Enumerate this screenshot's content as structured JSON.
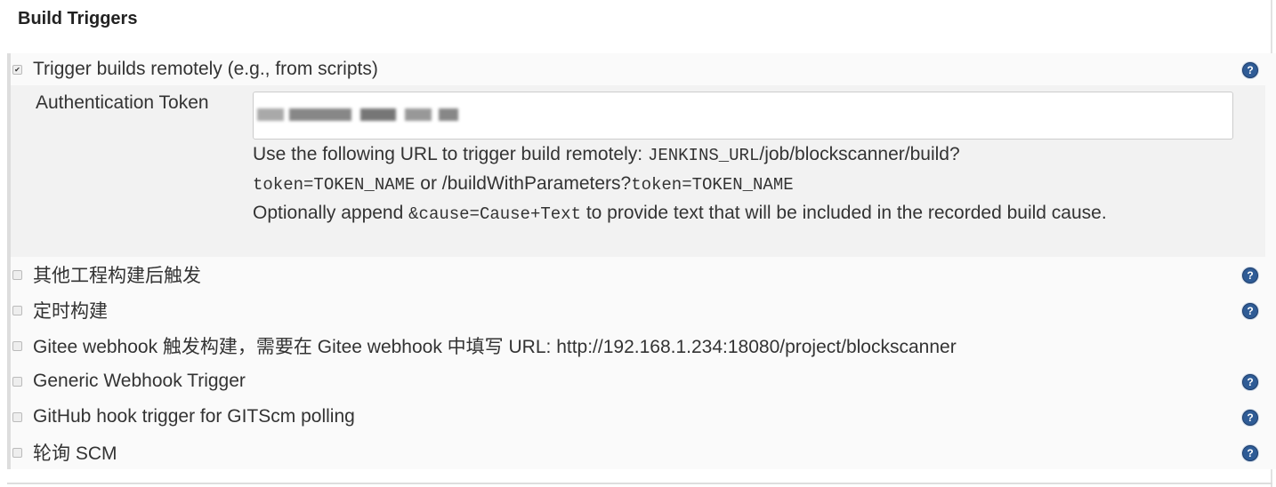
{
  "title": "Build Triggers",
  "remote": {
    "label": "Trigger builds remotely (e.g., from scripts)",
    "checked": true,
    "auth_label": "Authentication Token",
    "desc1a": "Use the following URL to trigger build remotely: ",
    "desc1code": "JENKINS_URL",
    "desc1b": "/job/blockscanner/build?",
    "desc2code1": "token=TOKEN_NAME",
    "desc2b": " or /buildWithParameters?",
    "desc2code2": "token=TOKEN_NAME",
    "desc3a": "Optionally append ",
    "desc3code": "&cause=Cause+Text",
    "desc3b": " to provide text that will be included in the recorded build cause."
  },
  "triggers": [
    {
      "label": "其他工程构建后触发",
      "checked": false,
      "help": true
    },
    {
      "label": "定时构建",
      "checked": false,
      "help": true
    },
    {
      "label": "Gitee webhook 触发构建，需要在 Gitee webhook 中填写 URL: http://192.168.1.234:18080/project/blockscanner",
      "checked": false,
      "help": false
    },
    {
      "label": "Generic Webhook Trigger",
      "checked": false,
      "help": true
    },
    {
      "label": "GitHub hook trigger for GITScm polling",
      "checked": false,
      "help": true
    },
    {
      "label": "轮询 SCM",
      "checked": false,
      "help": true
    }
  ],
  "help_icon": "question-circle-icon"
}
